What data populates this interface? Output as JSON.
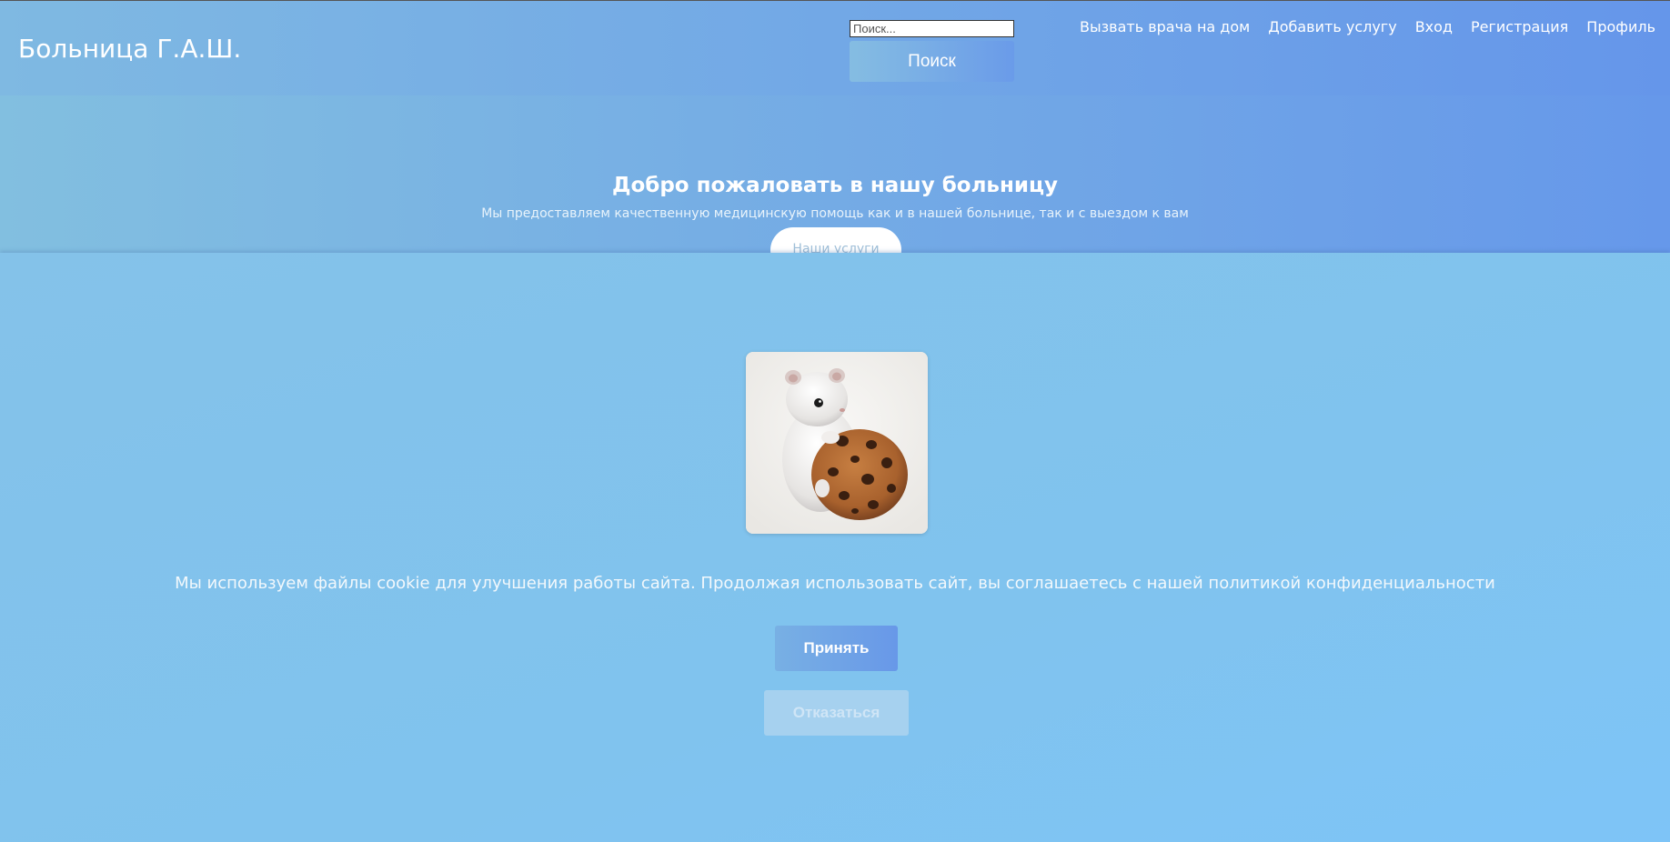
{
  "header": {
    "logo": "Больница Г.А.Ш.",
    "search": {
      "placeholder": "Поиск...",
      "value": "",
      "button_label": "Поиск"
    },
    "nav": [
      {
        "label": "Вызвать врача на дом"
      },
      {
        "label": "Добавить услугу"
      },
      {
        "label": "Вход"
      },
      {
        "label": "Регистрация"
      },
      {
        "label": "Профиль"
      }
    ]
  },
  "hero": {
    "title": "Добро пожаловать в нашу больницу",
    "subtitle": "Мы предоставляем качественную медицинскую помощь как и в нашей больнице, так и с выездом к вам",
    "button_label": "Наши услуги"
  },
  "cookie_banner": {
    "image": "hamster-with-cookie",
    "text": "Мы используем файлы cookie для улучшения работы сайта. Продолжая использовать сайт, вы соглашаетесь с нашей политикой конфиденциальности",
    "accept_label": "Принять",
    "decline_label": "Отказаться"
  },
  "colors": {
    "header_start": "#7fb9e2",
    "header_end": "#6596ea",
    "overlay": "#80c3ee",
    "accent_button": "#6898e8",
    "disabled_button": "#a6d1ef"
  }
}
